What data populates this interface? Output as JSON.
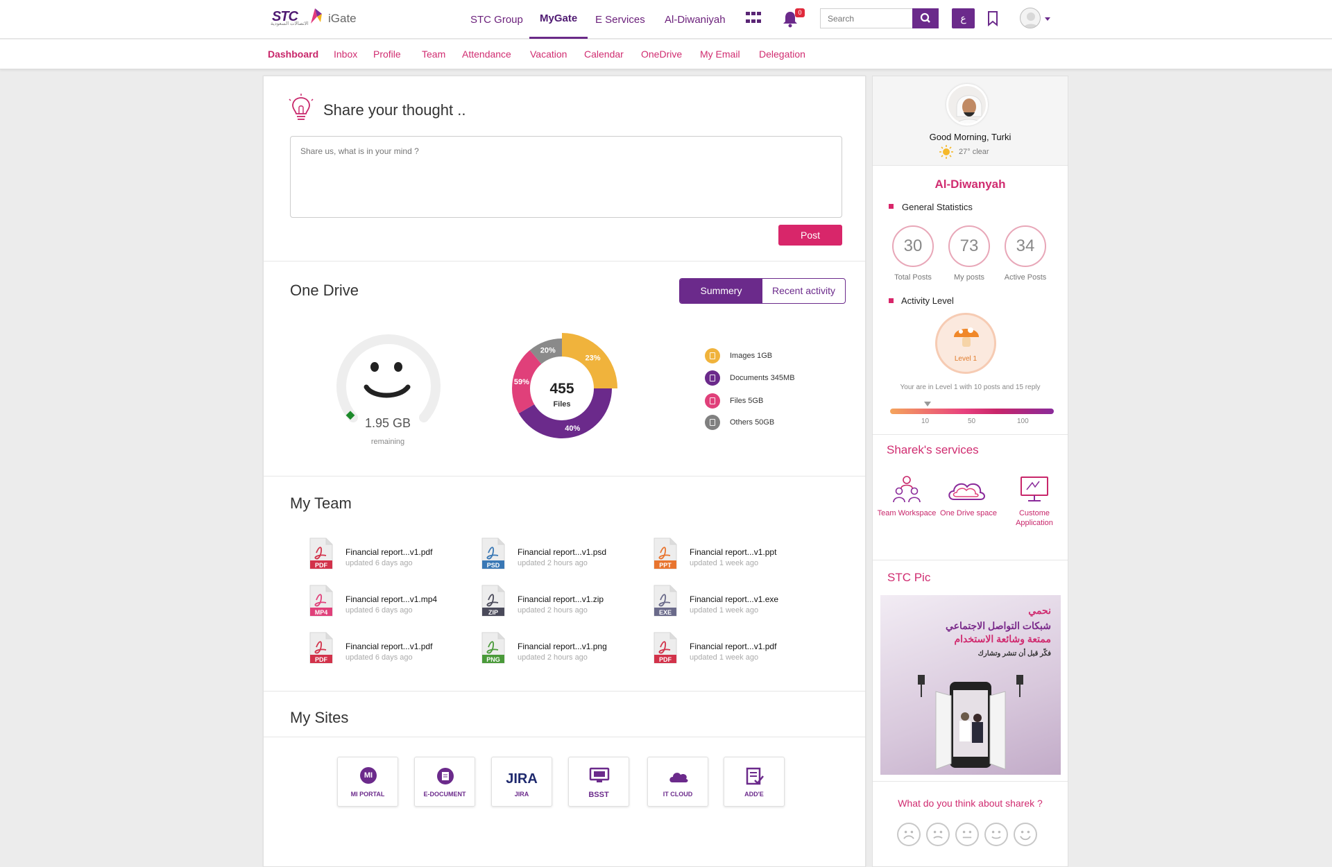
{
  "header": {
    "logo_text": "STC",
    "logo_sub": "الاتصالات السعودية",
    "app_name": "iGate",
    "top_nav": [
      "STC Group",
      "MyGate",
      "E Services",
      "Al-Diwaniyah"
    ],
    "active_top": "MyGate",
    "notification_count": "0",
    "search_placeholder": "Search",
    "lang_label": "ع"
  },
  "subnav": {
    "items": [
      "Dashboard",
      "Inbox",
      "Profile",
      "Team",
      "Attendance",
      "Vacation",
      "Calendar",
      "OneDrive",
      "My Email",
      "Delegation"
    ],
    "active": "Dashboard"
  },
  "share": {
    "title": "Share your thought ..",
    "placeholder": "Share us, what is in your mind ?",
    "post_label": "Post"
  },
  "onedrive": {
    "title": "One Drive",
    "tabs": [
      "Summery",
      "Recent activity"
    ],
    "active_tab": "Summery",
    "gauge": {
      "value": "1.95 GB",
      "caption": "remaining"
    },
    "donut": {
      "total": "455",
      "caption": "Files"
    },
    "legend": [
      {
        "label": "Images 1GB",
        "color": "#f0b33c"
      },
      {
        "label": "Documents 345MB",
        "color": "#6b2a8b"
      },
      {
        "label": "Files 5GB",
        "color": "#e0407a"
      },
      {
        "label": "Others 50GB",
        "color": "#808080"
      }
    ]
  },
  "chart_data": {
    "type": "pie",
    "categories": [
      "Images",
      "Documents",
      "Files",
      "Others"
    ],
    "values": [
      23,
      40,
      59,
      20
    ],
    "labels": [
      "23%",
      "40%",
      "59%",
      "20%"
    ],
    "colors": [
      "#f0b33c",
      "#6b2a8b",
      "#e0407a",
      "#8a8a8a"
    ],
    "center_text": "455",
    "center_caption": "Files"
  },
  "team": {
    "title": "My Team",
    "files": [
      {
        "name": "Financial report...v1.pdf",
        "updated": "updated 6 days ago",
        "type": "PDF",
        "color": "#d2324a"
      },
      {
        "name": "Financial report...v1.psd",
        "updated": "updated 2 hours ago",
        "type": "PSD",
        "color": "#3a78b5"
      },
      {
        "name": "Financial report...v1.ppt",
        "updated": "updated 1 week ago",
        "type": "PPT",
        "color": "#e8742e"
      },
      {
        "name": "Financial report...v1.mp4",
        "updated": "updated 6 days ago",
        "type": "MP4",
        "color": "#e0407a"
      },
      {
        "name": "Financial report...v1.zip",
        "updated": "updated 2 hours ago",
        "type": "ZIP",
        "color": "#4a4a5a"
      },
      {
        "name": "Financial report...v1.exe",
        "updated": "updated 1 week ago",
        "type": "EXE",
        "color": "#6a6a8a"
      },
      {
        "name": "Financial report...v1.pdf",
        "updated": "updated 6 days ago",
        "type": "PDF",
        "color": "#d2324a"
      },
      {
        "name": "Financial report...v1.png",
        "updated": "updated 2 hours ago",
        "type": "PNG",
        "color": "#4a9a3a"
      },
      {
        "name": "Financial report...v1.pdf",
        "updated": "updated 1 week ago",
        "type": "PDF",
        "color": "#d2324a"
      }
    ]
  },
  "sites": {
    "title": "My Sites",
    "items": [
      "MI PORTAL",
      "E-DOCUMENT",
      "JIRA",
      "BSST",
      "IT CLOUD",
      "ADD'E"
    ],
    "mi_mark": "MI",
    "jira_mark": "JIRA"
  },
  "profile": {
    "greeting": "Good Morning, Turki",
    "weather": "27° clear"
  },
  "diwanyah": {
    "title": "Al-Diwanyah",
    "general_stats_label": "General Statistics",
    "stats": [
      {
        "value": "30",
        "label": "Total Posts"
      },
      {
        "value": "73",
        "label": "My posts"
      },
      {
        "value": "34",
        "label": "Active Posts"
      }
    ],
    "activity_label": "Activity Level",
    "level_label": "Level 1",
    "level_text": "Your are in Level 1 with 10 posts and 15 reply",
    "scale": [
      "10",
      "50",
      "100"
    ]
  },
  "services": {
    "title": "Sharek's services",
    "items": [
      "Team Workspace",
      "One Drive space",
      "Custome Application"
    ]
  },
  "stcpic": {
    "title": "STC Pic",
    "line1": "نحمي",
    "line2": "شبكات التواصل الاجتماعي",
    "line3": "ممتعة وشائعة الاستخدام",
    "line4": "فكّر قبل أن تنشر وتشارك"
  },
  "feedback": {
    "title": "What do you think about sharek ?"
  }
}
